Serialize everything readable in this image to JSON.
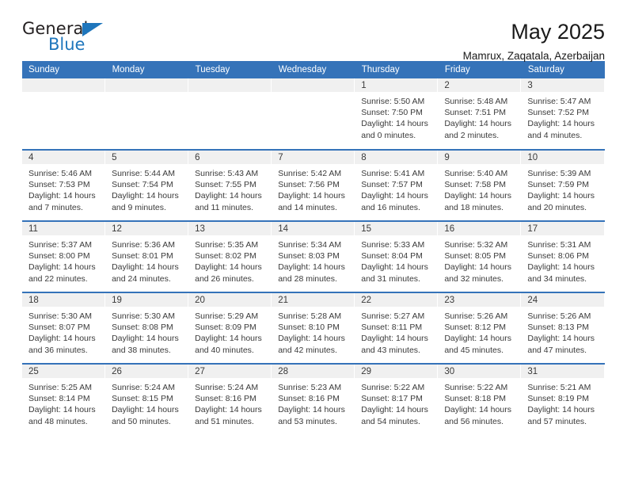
{
  "brand": {
    "name_part1": "General",
    "name_part2": "Blue",
    "triangle_icon": "triangle-icon",
    "accent_color": "#1f76bc"
  },
  "header": {
    "title": "May 2025",
    "location": "Mamrux, Zaqatala, Azerbaijan"
  },
  "calendar": {
    "header_bg": "#3573b9",
    "daynum_bg": "#f0f0f0",
    "weekdays": [
      "Sunday",
      "Monday",
      "Tuesday",
      "Wednesday",
      "Thursday",
      "Friday",
      "Saturday"
    ],
    "weeks": [
      [
        {
          "day": "",
          "sunrise": "",
          "sunset": "",
          "daylight_line1": "",
          "daylight_line2": ""
        },
        {
          "day": "",
          "sunrise": "",
          "sunset": "",
          "daylight_line1": "",
          "daylight_line2": ""
        },
        {
          "day": "",
          "sunrise": "",
          "sunset": "",
          "daylight_line1": "",
          "daylight_line2": ""
        },
        {
          "day": "",
          "sunrise": "",
          "sunset": "",
          "daylight_line1": "",
          "daylight_line2": ""
        },
        {
          "day": "1",
          "sunrise": "Sunrise: 5:50 AM",
          "sunset": "Sunset: 7:50 PM",
          "daylight_line1": "Daylight: 14 hours",
          "daylight_line2": "and 0 minutes."
        },
        {
          "day": "2",
          "sunrise": "Sunrise: 5:48 AM",
          "sunset": "Sunset: 7:51 PM",
          "daylight_line1": "Daylight: 14 hours",
          "daylight_line2": "and 2 minutes."
        },
        {
          "day": "3",
          "sunrise": "Sunrise: 5:47 AM",
          "sunset": "Sunset: 7:52 PM",
          "daylight_line1": "Daylight: 14 hours",
          "daylight_line2": "and 4 minutes."
        }
      ],
      [
        {
          "day": "4",
          "sunrise": "Sunrise: 5:46 AM",
          "sunset": "Sunset: 7:53 PM",
          "daylight_line1": "Daylight: 14 hours",
          "daylight_line2": "and 7 minutes."
        },
        {
          "day": "5",
          "sunrise": "Sunrise: 5:44 AM",
          "sunset": "Sunset: 7:54 PM",
          "daylight_line1": "Daylight: 14 hours",
          "daylight_line2": "and 9 minutes."
        },
        {
          "day": "6",
          "sunrise": "Sunrise: 5:43 AM",
          "sunset": "Sunset: 7:55 PM",
          "daylight_line1": "Daylight: 14 hours",
          "daylight_line2": "and 11 minutes."
        },
        {
          "day": "7",
          "sunrise": "Sunrise: 5:42 AM",
          "sunset": "Sunset: 7:56 PM",
          "daylight_line1": "Daylight: 14 hours",
          "daylight_line2": "and 14 minutes."
        },
        {
          "day": "8",
          "sunrise": "Sunrise: 5:41 AM",
          "sunset": "Sunset: 7:57 PM",
          "daylight_line1": "Daylight: 14 hours",
          "daylight_line2": "and 16 minutes."
        },
        {
          "day": "9",
          "sunrise": "Sunrise: 5:40 AM",
          "sunset": "Sunset: 7:58 PM",
          "daylight_line1": "Daylight: 14 hours",
          "daylight_line2": "and 18 minutes."
        },
        {
          "day": "10",
          "sunrise": "Sunrise: 5:39 AM",
          "sunset": "Sunset: 7:59 PM",
          "daylight_line1": "Daylight: 14 hours",
          "daylight_line2": "and 20 minutes."
        }
      ],
      [
        {
          "day": "11",
          "sunrise": "Sunrise: 5:37 AM",
          "sunset": "Sunset: 8:00 PM",
          "daylight_line1": "Daylight: 14 hours",
          "daylight_line2": "and 22 minutes."
        },
        {
          "day": "12",
          "sunrise": "Sunrise: 5:36 AM",
          "sunset": "Sunset: 8:01 PM",
          "daylight_line1": "Daylight: 14 hours",
          "daylight_line2": "and 24 minutes."
        },
        {
          "day": "13",
          "sunrise": "Sunrise: 5:35 AM",
          "sunset": "Sunset: 8:02 PM",
          "daylight_line1": "Daylight: 14 hours",
          "daylight_line2": "and 26 minutes."
        },
        {
          "day": "14",
          "sunrise": "Sunrise: 5:34 AM",
          "sunset": "Sunset: 8:03 PM",
          "daylight_line1": "Daylight: 14 hours",
          "daylight_line2": "and 28 minutes."
        },
        {
          "day": "15",
          "sunrise": "Sunrise: 5:33 AM",
          "sunset": "Sunset: 8:04 PM",
          "daylight_line1": "Daylight: 14 hours",
          "daylight_line2": "and 31 minutes."
        },
        {
          "day": "16",
          "sunrise": "Sunrise: 5:32 AM",
          "sunset": "Sunset: 8:05 PM",
          "daylight_line1": "Daylight: 14 hours",
          "daylight_line2": "and 32 minutes."
        },
        {
          "day": "17",
          "sunrise": "Sunrise: 5:31 AM",
          "sunset": "Sunset: 8:06 PM",
          "daylight_line1": "Daylight: 14 hours",
          "daylight_line2": "and 34 minutes."
        }
      ],
      [
        {
          "day": "18",
          "sunrise": "Sunrise: 5:30 AM",
          "sunset": "Sunset: 8:07 PM",
          "daylight_line1": "Daylight: 14 hours",
          "daylight_line2": "and 36 minutes."
        },
        {
          "day": "19",
          "sunrise": "Sunrise: 5:30 AM",
          "sunset": "Sunset: 8:08 PM",
          "daylight_line1": "Daylight: 14 hours",
          "daylight_line2": "and 38 minutes."
        },
        {
          "day": "20",
          "sunrise": "Sunrise: 5:29 AM",
          "sunset": "Sunset: 8:09 PM",
          "daylight_line1": "Daylight: 14 hours",
          "daylight_line2": "and 40 minutes."
        },
        {
          "day": "21",
          "sunrise": "Sunrise: 5:28 AM",
          "sunset": "Sunset: 8:10 PM",
          "daylight_line1": "Daylight: 14 hours",
          "daylight_line2": "and 42 minutes."
        },
        {
          "day": "22",
          "sunrise": "Sunrise: 5:27 AM",
          "sunset": "Sunset: 8:11 PM",
          "daylight_line1": "Daylight: 14 hours",
          "daylight_line2": "and 43 minutes."
        },
        {
          "day": "23",
          "sunrise": "Sunrise: 5:26 AM",
          "sunset": "Sunset: 8:12 PM",
          "daylight_line1": "Daylight: 14 hours",
          "daylight_line2": "and 45 minutes."
        },
        {
          "day": "24",
          "sunrise": "Sunrise: 5:26 AM",
          "sunset": "Sunset: 8:13 PM",
          "daylight_line1": "Daylight: 14 hours",
          "daylight_line2": "and 47 minutes."
        }
      ],
      [
        {
          "day": "25",
          "sunrise": "Sunrise: 5:25 AM",
          "sunset": "Sunset: 8:14 PM",
          "daylight_line1": "Daylight: 14 hours",
          "daylight_line2": "and 48 minutes."
        },
        {
          "day": "26",
          "sunrise": "Sunrise: 5:24 AM",
          "sunset": "Sunset: 8:15 PM",
          "daylight_line1": "Daylight: 14 hours",
          "daylight_line2": "and 50 minutes."
        },
        {
          "day": "27",
          "sunrise": "Sunrise: 5:24 AM",
          "sunset": "Sunset: 8:16 PM",
          "daylight_line1": "Daylight: 14 hours",
          "daylight_line2": "and 51 minutes."
        },
        {
          "day": "28",
          "sunrise": "Sunrise: 5:23 AM",
          "sunset": "Sunset: 8:16 PM",
          "daylight_line1": "Daylight: 14 hours",
          "daylight_line2": "and 53 minutes."
        },
        {
          "day": "29",
          "sunrise": "Sunrise: 5:22 AM",
          "sunset": "Sunset: 8:17 PM",
          "daylight_line1": "Daylight: 14 hours",
          "daylight_line2": "and 54 minutes."
        },
        {
          "day": "30",
          "sunrise": "Sunrise: 5:22 AM",
          "sunset": "Sunset: 8:18 PM",
          "daylight_line1": "Daylight: 14 hours",
          "daylight_line2": "and 56 minutes."
        },
        {
          "day": "31",
          "sunrise": "Sunrise: 5:21 AM",
          "sunset": "Sunset: 8:19 PM",
          "daylight_line1": "Daylight: 14 hours",
          "daylight_line2": "and 57 minutes."
        }
      ]
    ]
  }
}
